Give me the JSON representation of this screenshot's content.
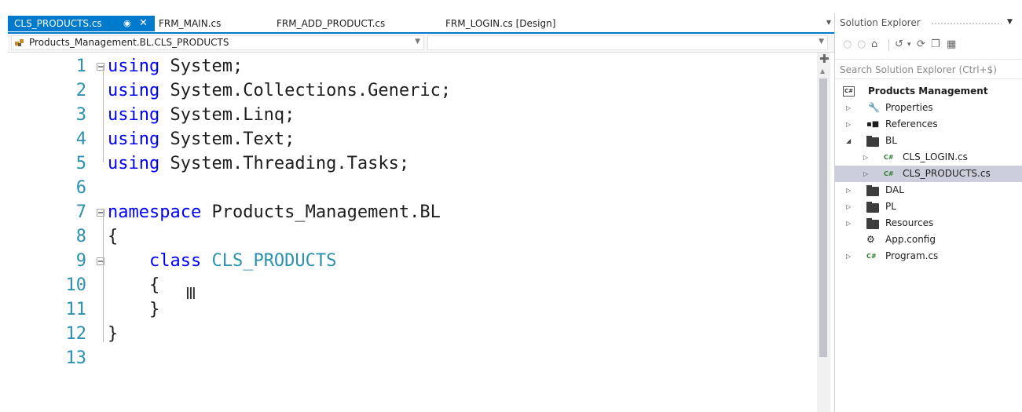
{
  "tabs": [
    {
      "label": "CLS_PRODUCTS.cs",
      "active": true
    },
    {
      "label": "FRM_MAIN.cs",
      "active": false
    },
    {
      "label": "FRM_ADD_PRODUCT.cs",
      "active": false
    },
    {
      "label": "FRM_LOGIN.cs [Design]",
      "active": false
    }
  ],
  "tab_icons": {
    "pin": "pin-icon",
    "close": "close-icon",
    "overflow": "tab-dropdown-icon"
  },
  "navbar": {
    "type_scope": "Products_Management.BL.CLS_PRODUCTS",
    "member_scope": ""
  },
  "editor": {
    "lines": [
      {
        "num": "1",
        "tokens": [
          {
            "t": "using",
            "c": "kw"
          },
          {
            "t": " System;",
            "c": "tx"
          }
        ],
        "fold": true
      },
      {
        "num": "2",
        "tokens": [
          {
            "t": "using",
            "c": "kw"
          },
          {
            "t": " System.Collections.Generic;",
            "c": "tx"
          }
        ]
      },
      {
        "num": "3",
        "tokens": [
          {
            "t": "using",
            "c": "kw"
          },
          {
            "t": " System.Linq;",
            "c": "tx"
          }
        ]
      },
      {
        "num": "4",
        "tokens": [
          {
            "t": "using",
            "c": "kw"
          },
          {
            "t": " System.Text;",
            "c": "tx"
          }
        ]
      },
      {
        "num": "5",
        "tokens": [
          {
            "t": "using",
            "c": "kw"
          },
          {
            "t": " System.Threading.Tasks;",
            "c": "tx"
          }
        ]
      },
      {
        "num": "6",
        "tokens": []
      },
      {
        "num": "7",
        "tokens": [
          {
            "t": "namespace",
            "c": "kw"
          },
          {
            "t": " Products_Management.BL",
            "c": "tx"
          }
        ],
        "fold": true
      },
      {
        "num": "8",
        "tokens": [
          {
            "t": "{",
            "c": "tx"
          }
        ]
      },
      {
        "num": "9",
        "tokens": [
          {
            "t": "    class",
            "c": "kw"
          },
          {
            "t": " CLS_PRODUCTS",
            "c": "tp"
          }
        ],
        "fold": true
      },
      {
        "num": "10",
        "tokens": [
          {
            "t": "    {",
            "c": "tx"
          }
        ]
      },
      {
        "num": "11",
        "tokens": [
          {
            "t": "    }",
            "c": "tx"
          }
        ]
      },
      {
        "num": "12",
        "tokens": [
          {
            "t": "}",
            "c": "tx"
          }
        ]
      },
      {
        "num": "13",
        "tokens": []
      }
    ],
    "colors": {
      "keyword": "#0000ff",
      "type": "#2b91af",
      "line_number": "#2b91af",
      "text": "#1e1e1e"
    }
  },
  "solution_explorer": {
    "title": "Solution Explorer",
    "search_placeholder": "Search Solution Explorer (Ctrl+$)",
    "toolbar_icons": [
      "back-icon",
      "forward-icon",
      "home-icon",
      "sync-icon",
      "refresh-icon",
      "collapse-all-icon",
      "show-all-files-icon"
    ],
    "items": [
      {
        "label": "Products Management",
        "icon": "csharp-project-icon",
        "bold": true
      },
      {
        "label": "Properties",
        "icon": "wrench-icon",
        "expander": "collapsed"
      },
      {
        "label": "References",
        "icon": "references-icon",
        "expander": "collapsed"
      },
      {
        "label": "BL",
        "icon": "folder-icon",
        "expander": "expanded"
      },
      {
        "label": "CLS_LOGIN.cs",
        "icon": "csharp-file-icon",
        "expander": "collapsed"
      },
      {
        "label": "CLS_PRODUCTS.cs",
        "icon": "csharp-file-icon",
        "expander": "collapsed",
        "selected": true
      },
      {
        "label": "DAL",
        "icon": "folder-icon",
        "expander": "collapsed"
      },
      {
        "label": "PL",
        "icon": "folder-icon",
        "expander": "collapsed"
      },
      {
        "label": "Resources",
        "icon": "folder-icon",
        "expander": "collapsed"
      },
      {
        "label": "App.config",
        "icon": "config-file-icon"
      },
      {
        "label": "Program.cs",
        "icon": "csharp-file-icon",
        "expander": "collapsed"
      }
    ]
  },
  "accent_color": "#007acc",
  "selection_color": "#cccedb"
}
